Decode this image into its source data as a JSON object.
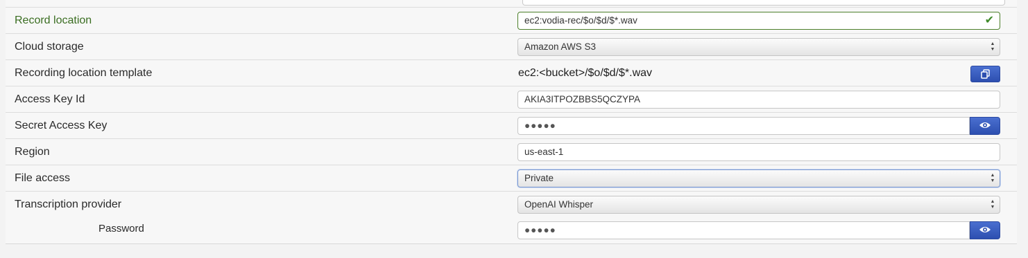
{
  "rows": [
    {
      "label": "Record location",
      "value": "ec2:vodia-rec/$o/$d/$*.wav"
    },
    {
      "label": "Cloud storage",
      "value": "Amazon AWS S3"
    },
    {
      "label": "Recording location template",
      "value": "ec2:<bucket>/$o/$d/$*.wav"
    },
    {
      "label": "Access Key Id",
      "value": "AKIA3ITPOZBBS5QCZYPA"
    },
    {
      "label": "Secret Access Key",
      "value": "●●●●●"
    },
    {
      "label": "Region",
      "value": "us-east-1"
    },
    {
      "label": "File access",
      "value": "Private"
    },
    {
      "label": "Transcription provider",
      "value": "OpenAI Whisper"
    },
    {
      "label": "Password",
      "value": "●●●●●"
    }
  ],
  "icons": {
    "valid": "check-icon",
    "copy": "copy-icon",
    "reveal": "eye-icon",
    "select": "select-arrows-icon"
  },
  "colors": {
    "valid_label": "#3b6e22",
    "valid_check": "#3f8a2a",
    "button_blue": "#2d4fb0"
  }
}
